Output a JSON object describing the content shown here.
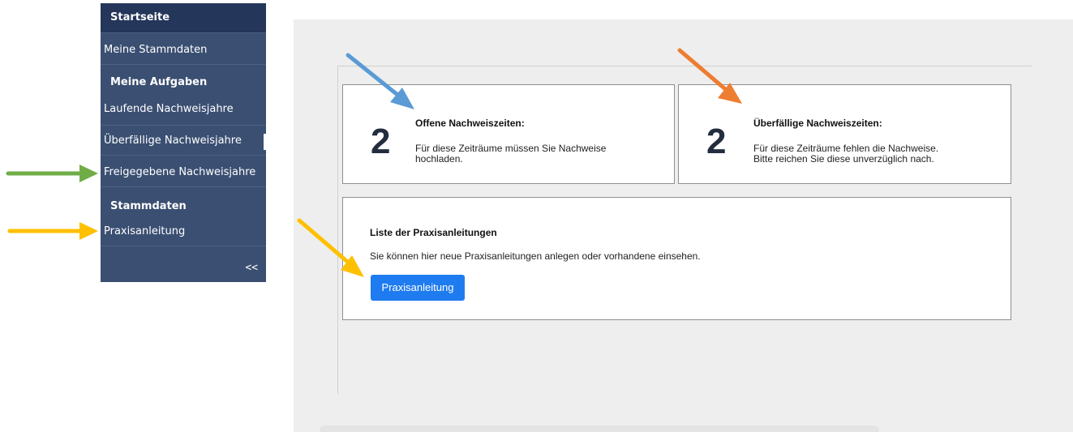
{
  "sidebar": {
    "items": [
      {
        "label": "Startseite"
      },
      {
        "label": "Meine Stammdaten"
      },
      {
        "label": "Meine Aufgaben"
      },
      {
        "label": "Laufende Nachweisjahre"
      },
      {
        "label": "Überfällige Nachweisjahre"
      },
      {
        "label": "Freigegebene Nachweisjahre"
      },
      {
        "label": "Stammdaten"
      },
      {
        "label": "Praxisanleitung"
      }
    ],
    "collapse_label": "<<"
  },
  "cards": {
    "open": {
      "count": "2",
      "title": "Offene Nachweiszeiten:",
      "line1": "Für diese Zeiträume müssen Sie Nachweise",
      "line2": "hochladen."
    },
    "overdue": {
      "count": "2",
      "title": "Überfällige Nachweiszeiten:",
      "line1": "Für diese Zeiträume fehlen die Nachweise.",
      "line2": "Bitte reichen Sie diese unverzüglich nach."
    },
    "list": {
      "title": "Liste der Praxisanleitungen",
      "text": "Sie können hier neue Praxisanleitungen anlegen oder vorhandene einsehen.",
      "button_label": "Praxisanleitung"
    }
  },
  "colors": {
    "sidebar_bg": "#3b4f72",
    "sidebar_active": "#24365a",
    "button": "#1e7cf0",
    "arrow_blue": "#5b9bd5",
    "arrow_orange": "#ed7d31",
    "arrow_green": "#70ad47",
    "arrow_yellow": "#ffc000"
  }
}
